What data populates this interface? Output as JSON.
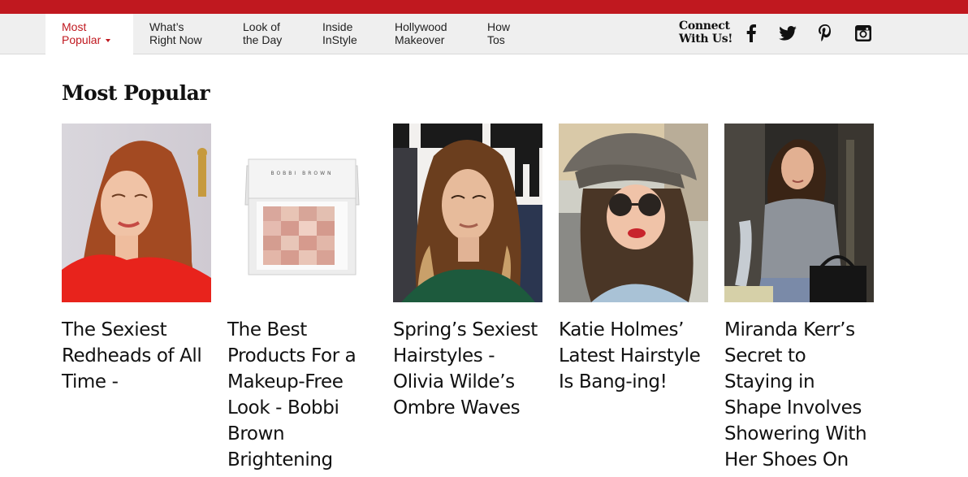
{
  "nav": {
    "items": [
      {
        "line1": "Most",
        "line2": "Popular"
      },
      {
        "line1": "What’s",
        "line2": "Right Now"
      },
      {
        "line1": "Look of",
        "line2": "the Day"
      },
      {
        "line1": "Inside",
        "line2": "InStyle"
      },
      {
        "line1": "Hollywood",
        "line2": "Makeover"
      },
      {
        "line1": "How",
        "line2": "Tos"
      }
    ],
    "connect_line1": "Connect",
    "connect_line2": "With Us!",
    "social_icons": [
      "facebook-icon",
      "twitter-icon",
      "pinterest-icon",
      "instagram-icon"
    ]
  },
  "colors": {
    "brand_red": "#c0181f",
    "nav_bg": "#efefef"
  },
  "section": {
    "title": "Most Popular"
  },
  "cards": [
    {
      "title": "The Sexiest Redheads of All Time -"
    },
    {
      "title": "The Best Products For a Makeup-Free Look - Bobbi Brown Brightening"
    },
    {
      "title": "Spring’s Sexiest Hairstyles - Olivia Wilde’s Ombre Waves"
    },
    {
      "title": "Katie Holmes’ Latest Hairstyle Is Bang-ing!"
    },
    {
      "title": "Miranda Kerr’s Secret to Staying in Shape Involves Showering With Her Shoes On"
    }
  ],
  "product": {
    "brand_text": "BOBBI BROWN"
  }
}
